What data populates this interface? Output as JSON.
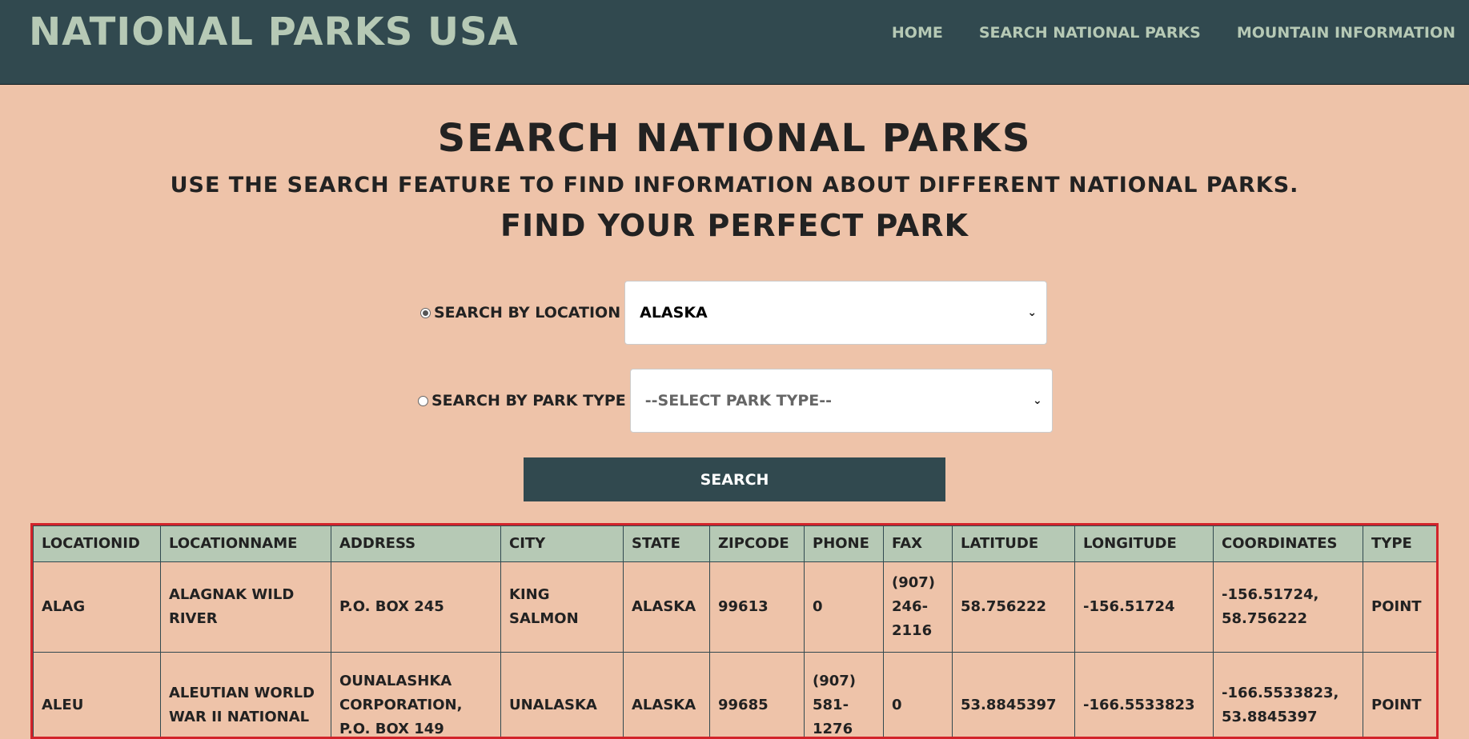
{
  "brand": "National Parks USA",
  "nav": {
    "home": "Home",
    "search": "Search National Parks",
    "mountain": "Mountain Information"
  },
  "headings": {
    "title": "Search National Parks",
    "subtitle": "Use the search feature to find information about different national parks.",
    "tagline": "Find your perfect park"
  },
  "search": {
    "location_label": "Search by Location",
    "location_value": "Alaska",
    "location_checked": true,
    "type_label": "Search by Park Type",
    "type_placeholder": "--Select Park Type--",
    "type_checked": false,
    "button": "Search"
  },
  "table": {
    "columns": [
      "LocationID",
      "LocationName",
      "Address",
      "City",
      "State",
      "ZipCode",
      "Phone",
      "Fax",
      "Latitude",
      "Longitude",
      "Coordinates",
      "Type"
    ],
    "rows": [
      [
        "ALAG",
        "Alagnak Wild River",
        "P.O. Box 245",
        "King Salmon",
        "Alaska",
        "99613",
        "0",
        "(907) 246-2116",
        "58.756222",
        "-156.51724",
        "-156.51724, 58.756222",
        "Point"
      ],
      [
        "ALEU",
        "Aleutian World War II National",
        "Ounalashka Corporation, P.O. Box 149",
        "Unalaska",
        "Alaska",
        "99685",
        "(907) 581-1276",
        "0",
        "53.8845397",
        "-166.5533823",
        "-166.5533823, 53.8845397",
        "Point"
      ]
    ]
  },
  "colors": {
    "header_bg": "#31494f",
    "accent": "#b6c9b5",
    "page_bg": "#eec3a9",
    "table_border": "#d2232a"
  }
}
